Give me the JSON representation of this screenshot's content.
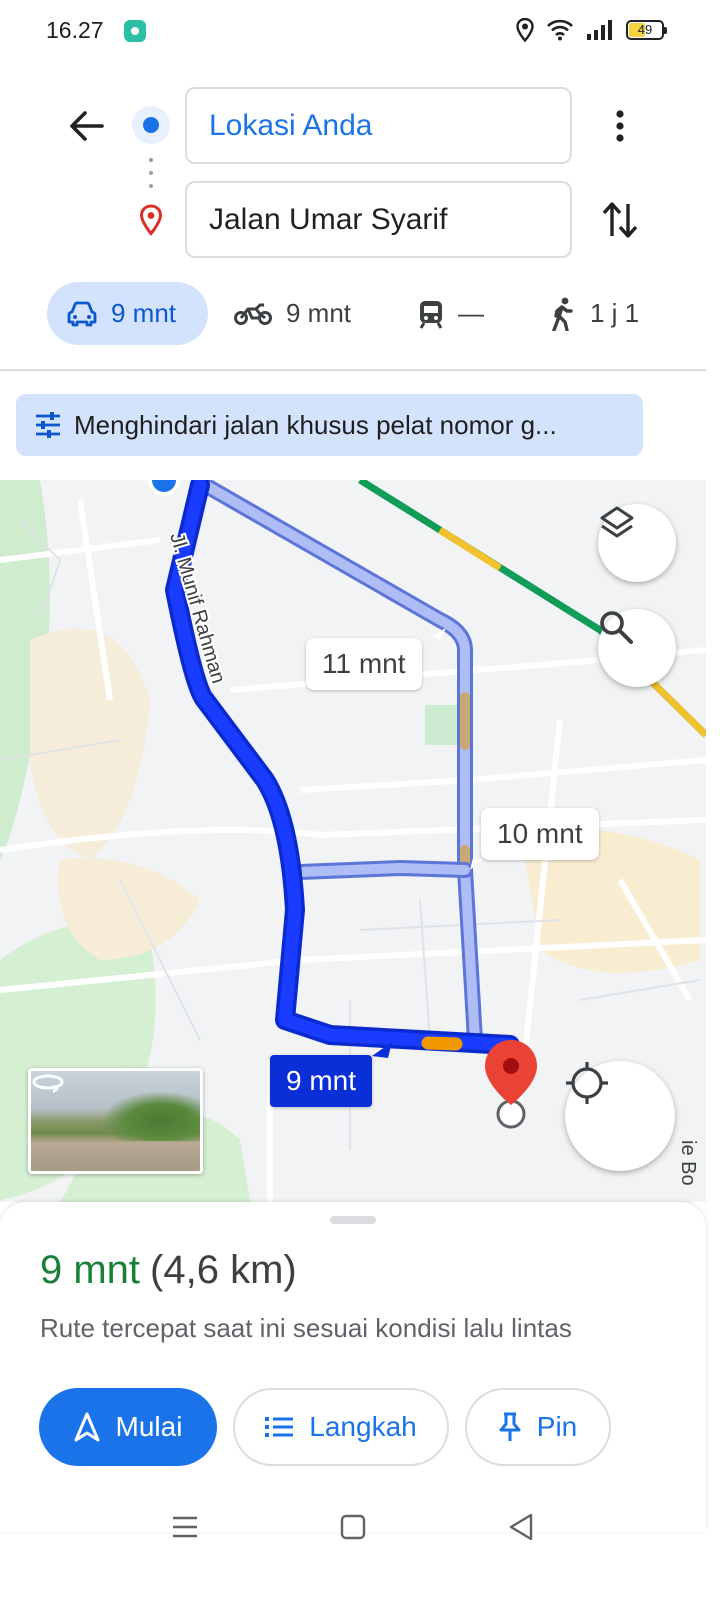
{
  "status_bar": {
    "time": "16.27",
    "battery_level": "49",
    "battery_fraction": 0.49,
    "icons": [
      "app-notification-icon",
      "location-icon",
      "wifi-icon",
      "signal-icon",
      "battery-icon"
    ]
  },
  "header": {
    "origin": "Lokasi Anda",
    "destination": "Jalan Umar Syarif"
  },
  "modes": {
    "drive": "9 mnt",
    "motorcycle": "9 mnt",
    "transit": "—",
    "walk": "1 j 1"
  },
  "options_chip": {
    "label": "Menghindari jalan khusus pelat nomor g..."
  },
  "map": {
    "street_name": "Jl. Munif Rahman",
    "edge_street_name": "ie Bo",
    "route_times": {
      "alt1": "11 mnt",
      "alt2": "10 mnt",
      "selected": "9 mnt"
    }
  },
  "summary": {
    "duration": "9 mnt",
    "distance": "(4,6 km)",
    "note": "Rute tercepat saat ini sesuai kondisi lalu lintas"
  },
  "actions": {
    "start": "Mulai",
    "steps": "Langkah",
    "pin": "Pin"
  },
  "colors": {
    "accent": "#1a73e8",
    "route_selected": "#0b3cf0",
    "route_alt": "#a8b8f5",
    "duration_green": "#188038",
    "chip_bg": "#d3e3fd",
    "destination_pin": "#ea4335"
  }
}
